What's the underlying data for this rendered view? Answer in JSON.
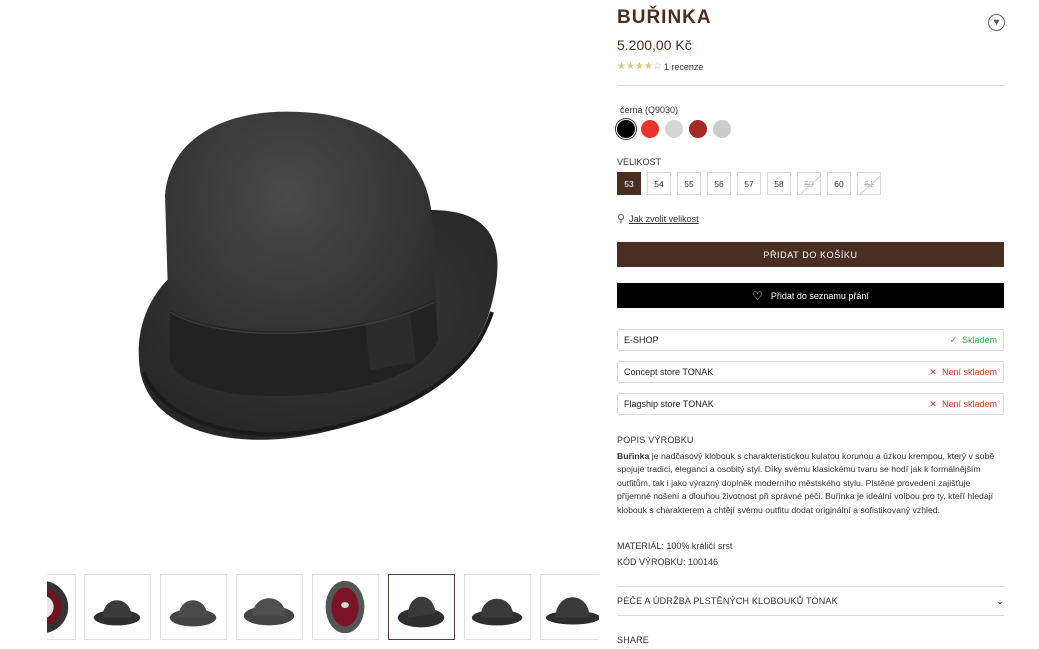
{
  "product": {
    "title": "BUŘINKA",
    "price": "5.200,00 Kč",
    "stars": "★★★★☆",
    "reviews": "1 recenze",
    "wish_icon": "heart-circle-icon"
  },
  "color": {
    "label": "černá (Q9030)",
    "swatches": [
      {
        "name": "black",
        "hex": "#000000"
      },
      {
        "name": "red",
        "hex": "#e8342b"
      },
      {
        "name": "light-grey",
        "hex": "#d6d6d6"
      },
      {
        "name": "dark-red",
        "hex": "#a22b26"
      },
      {
        "name": "grey",
        "hex": "#cccccc"
      }
    ]
  },
  "size": {
    "label": "VELIKOST",
    "options": [
      {
        "value": "53",
        "state": "selected"
      },
      {
        "value": "54",
        "state": "available"
      },
      {
        "value": "55",
        "state": "available"
      },
      {
        "value": "56",
        "state": "available"
      },
      {
        "value": "57",
        "state": "available"
      },
      {
        "value": "58",
        "state": "available"
      },
      {
        "value": "59",
        "state": "disabled"
      },
      {
        "value": "60",
        "state": "available"
      },
      {
        "value": "61",
        "state": "disabled"
      }
    ],
    "guide": "Jak zvolit velikost"
  },
  "buttons": {
    "cart": "PŘIDAT DO KOŠÍKU",
    "wishlist": "Přidat do seznamu přání"
  },
  "stores": [
    {
      "name": "E-SHOP",
      "status": "Skladem",
      "available": true
    },
    {
      "name": "Concept store TONAK",
      "status": "Není skladem",
      "available": false
    },
    {
      "name": "Flagship store TONAK",
      "status": "Není skladem",
      "available": false
    }
  ],
  "description": {
    "heading": "POPIS VÝROBKU",
    "lead": "Buřinka",
    "text": " je nadčasový klobouk s charakteristickou kulatou korunou a úzkou krempou, který v sobě spojuje tradici, eleganci a osobitý styl. Díky svému klasickému tvaru se hodí jak k formálnějším outfitům, tak i jako výrazný doplněk moderního městského stylu. Plstěné provedení zajišťuje příjemné nošení a dlouhou životnost při správné péči. Buřinka je ideální volbou pro ty, kteří hledají klobouk s charakterem a chtějí svému outfitu dodat originální a sofistikovaný vzhled.",
    "material": "MATERIÁL: 100% králičí srst",
    "code": "KÓD VÝROBKU: 100146"
  },
  "care": {
    "label": "PÉČE A ÚDRŽBA PLSTĚNÝCH KLOBOUKŮ TONAK",
    "icon": "chevron-down-icon"
  },
  "share": "SHARE",
  "colors": {
    "brand": "#4a2e22",
    "ok": "#4aa24a",
    "no": "#c0392b"
  }
}
